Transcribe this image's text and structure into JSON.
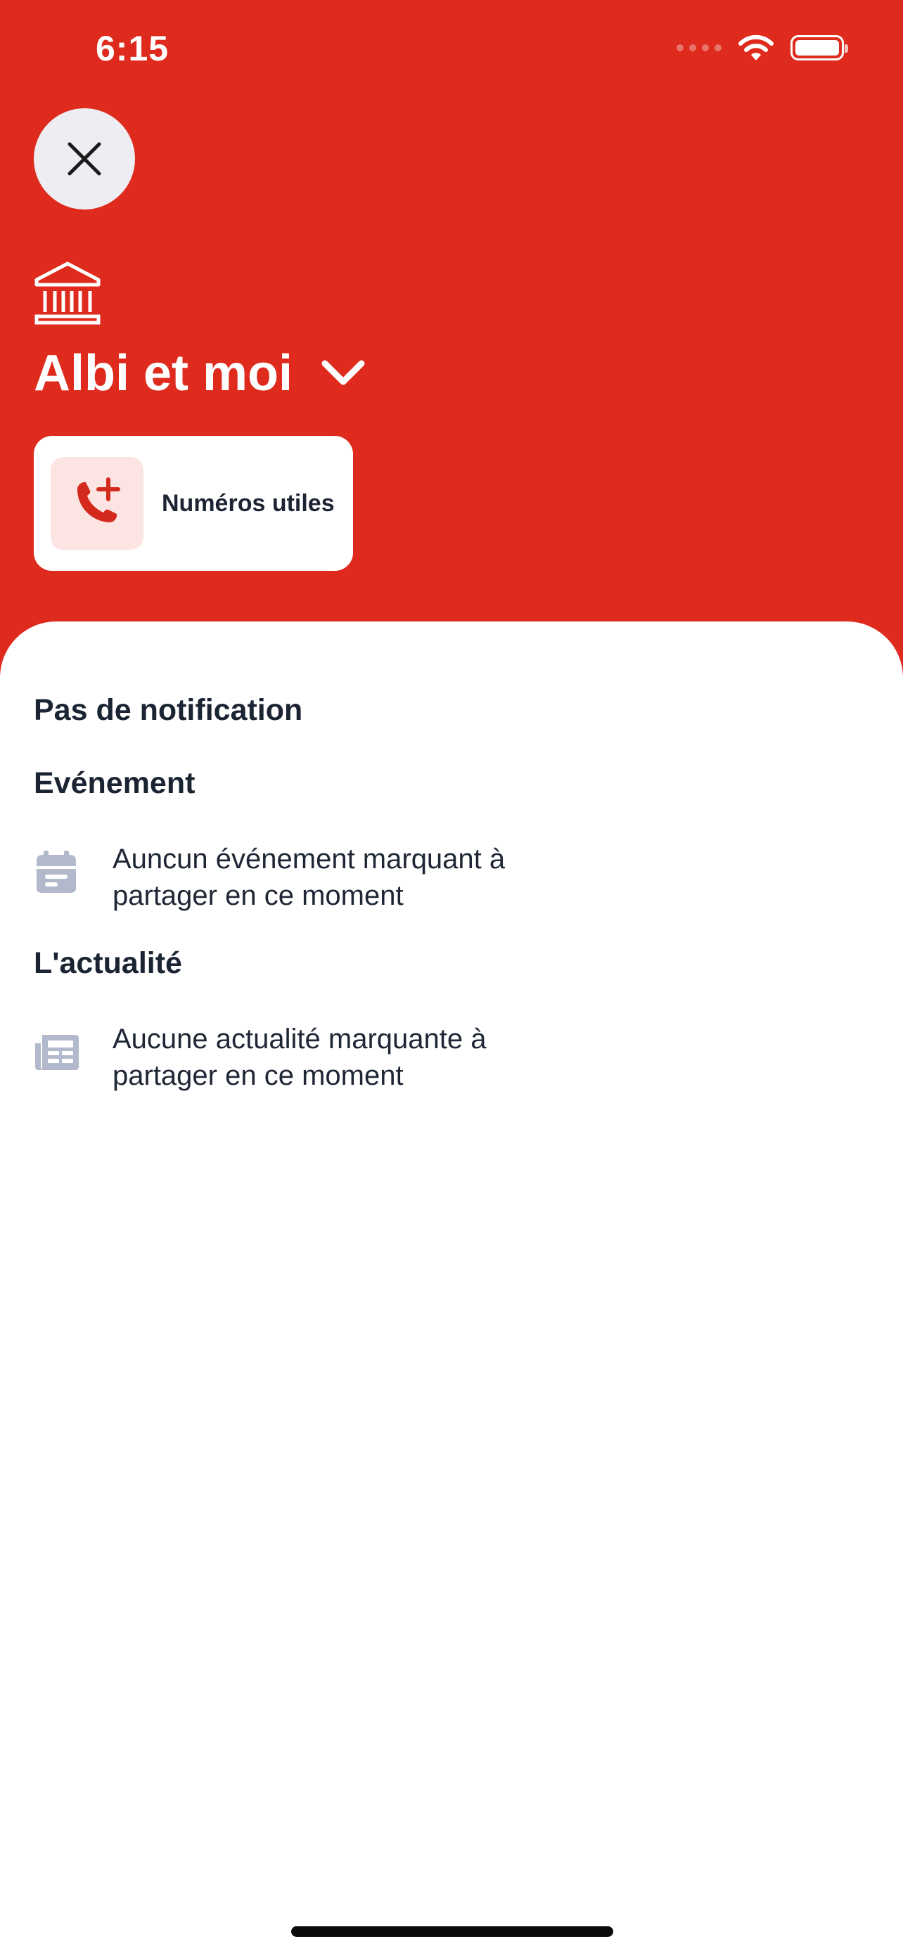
{
  "status_bar": {
    "time": "6:15"
  },
  "header": {
    "title": "Albi et moi",
    "background_color": "#de2b1e",
    "quick_action": {
      "label": "Numéros utiles",
      "icon": "phone-plus-icon"
    }
  },
  "notifications": {
    "heading": "Pas de notification",
    "sections": [
      {
        "title": "Evénement",
        "icon": "calendar-icon",
        "message": "Auncun événement marquant à partager en ce moment"
      },
      {
        "title": "L'actualité",
        "icon": "newspaper-icon",
        "message": "Aucune actualité marquante à partager en ce moment"
      }
    ]
  }
}
